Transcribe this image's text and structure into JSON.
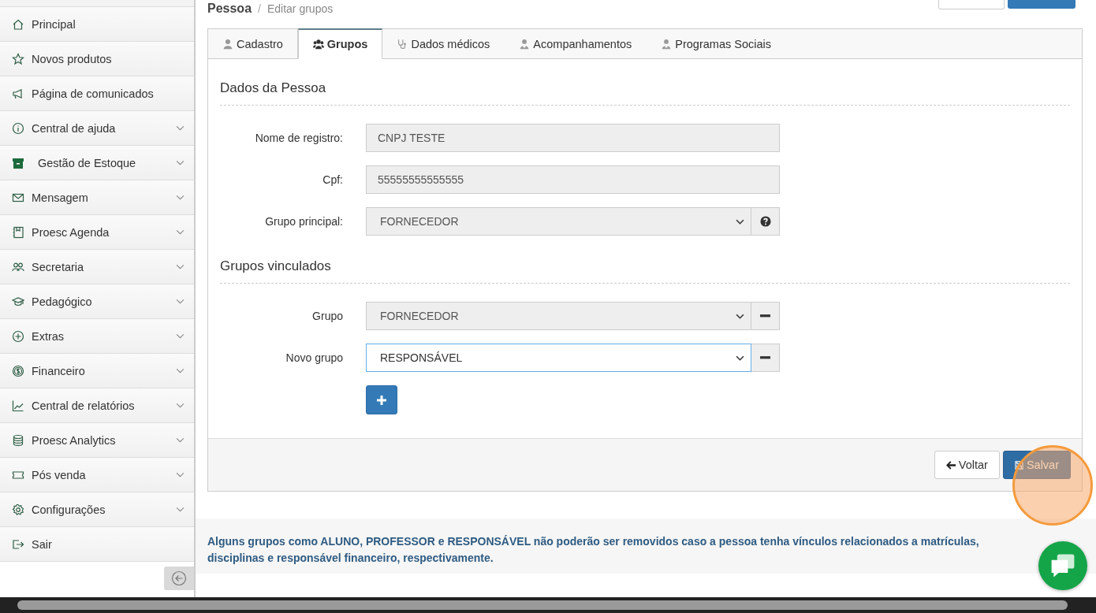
{
  "page_header": {
    "title": "Pessoa",
    "separator": "/",
    "subtitle": "Editar grupos"
  },
  "sidebar": {
    "items": [
      {
        "label": "Principal",
        "expandable": false
      },
      {
        "label": "Novos produtos",
        "expandable": false
      },
      {
        "label": "Página de comunicados",
        "expandable": false
      },
      {
        "label": "Central de ajuda",
        "expandable": true
      },
      {
        "label": "Gestão de Estoque",
        "expandable": true
      },
      {
        "label": "Mensagem",
        "expandable": true
      },
      {
        "label": "Proesc Agenda",
        "expandable": true
      },
      {
        "label": "Secretaria",
        "expandable": true
      },
      {
        "label": "Pedagógico",
        "expandable": true
      },
      {
        "label": "Extras",
        "expandable": true
      },
      {
        "label": "Financeiro",
        "expandable": true
      },
      {
        "label": "Central de relatórios",
        "expandable": true
      },
      {
        "label": "Proesc Analytics",
        "expandable": true
      },
      {
        "label": "Pós venda",
        "expandable": true
      },
      {
        "label": "Configurações",
        "expandable": true
      },
      {
        "label": "Sair",
        "expandable": false
      }
    ]
  },
  "tabs": [
    {
      "label": "Cadastro",
      "selected": false
    },
    {
      "label": "Grupos",
      "selected": true
    },
    {
      "label": "Dados médicos",
      "selected": false
    },
    {
      "label": "Acompanhamentos",
      "selected": false
    },
    {
      "label": "Programas Sociais",
      "selected": false
    }
  ],
  "sections": [
    {
      "title": "Dados da Pessoa",
      "rows": [
        {
          "label": "Nome de registro:",
          "value": "CNPJ TESTE",
          "kind": "readonly",
          "focused": false
        },
        {
          "label": "Cpf:",
          "value": "55555555555555",
          "kind": "readonly",
          "focused": false
        },
        {
          "label": "Grupo principal:",
          "value": "FORNECEDOR",
          "kind": "select",
          "addon": {
            "kind": "help"
          },
          "focused": false
        }
      ]
    },
    {
      "title": "Grupos vinculados",
      "rows": [
        {
          "label": "Grupo",
          "value": "FORNECEDOR",
          "kind": "select",
          "addon": {
            "kind": "remove"
          },
          "focused": false
        },
        {
          "label": "Novo grupo",
          "value": "RESPONSÁVEL",
          "kind": "select",
          "addon": {
            "kind": "remove"
          },
          "focused": true
        }
      ]
    }
  ],
  "footer_buttons": [
    {
      "label": "Voltar",
      "kind": "back"
    },
    {
      "label": "Salvar",
      "kind": "save"
    }
  ],
  "notice": "Alguns grupos como ALUNO, PROFESSOR e RESPONSÁVEL não poderão ser removidos caso a pessoa tenha vínculos relacionados a matrículas, disciplinas e responsável financeiro, respectivamente."
}
